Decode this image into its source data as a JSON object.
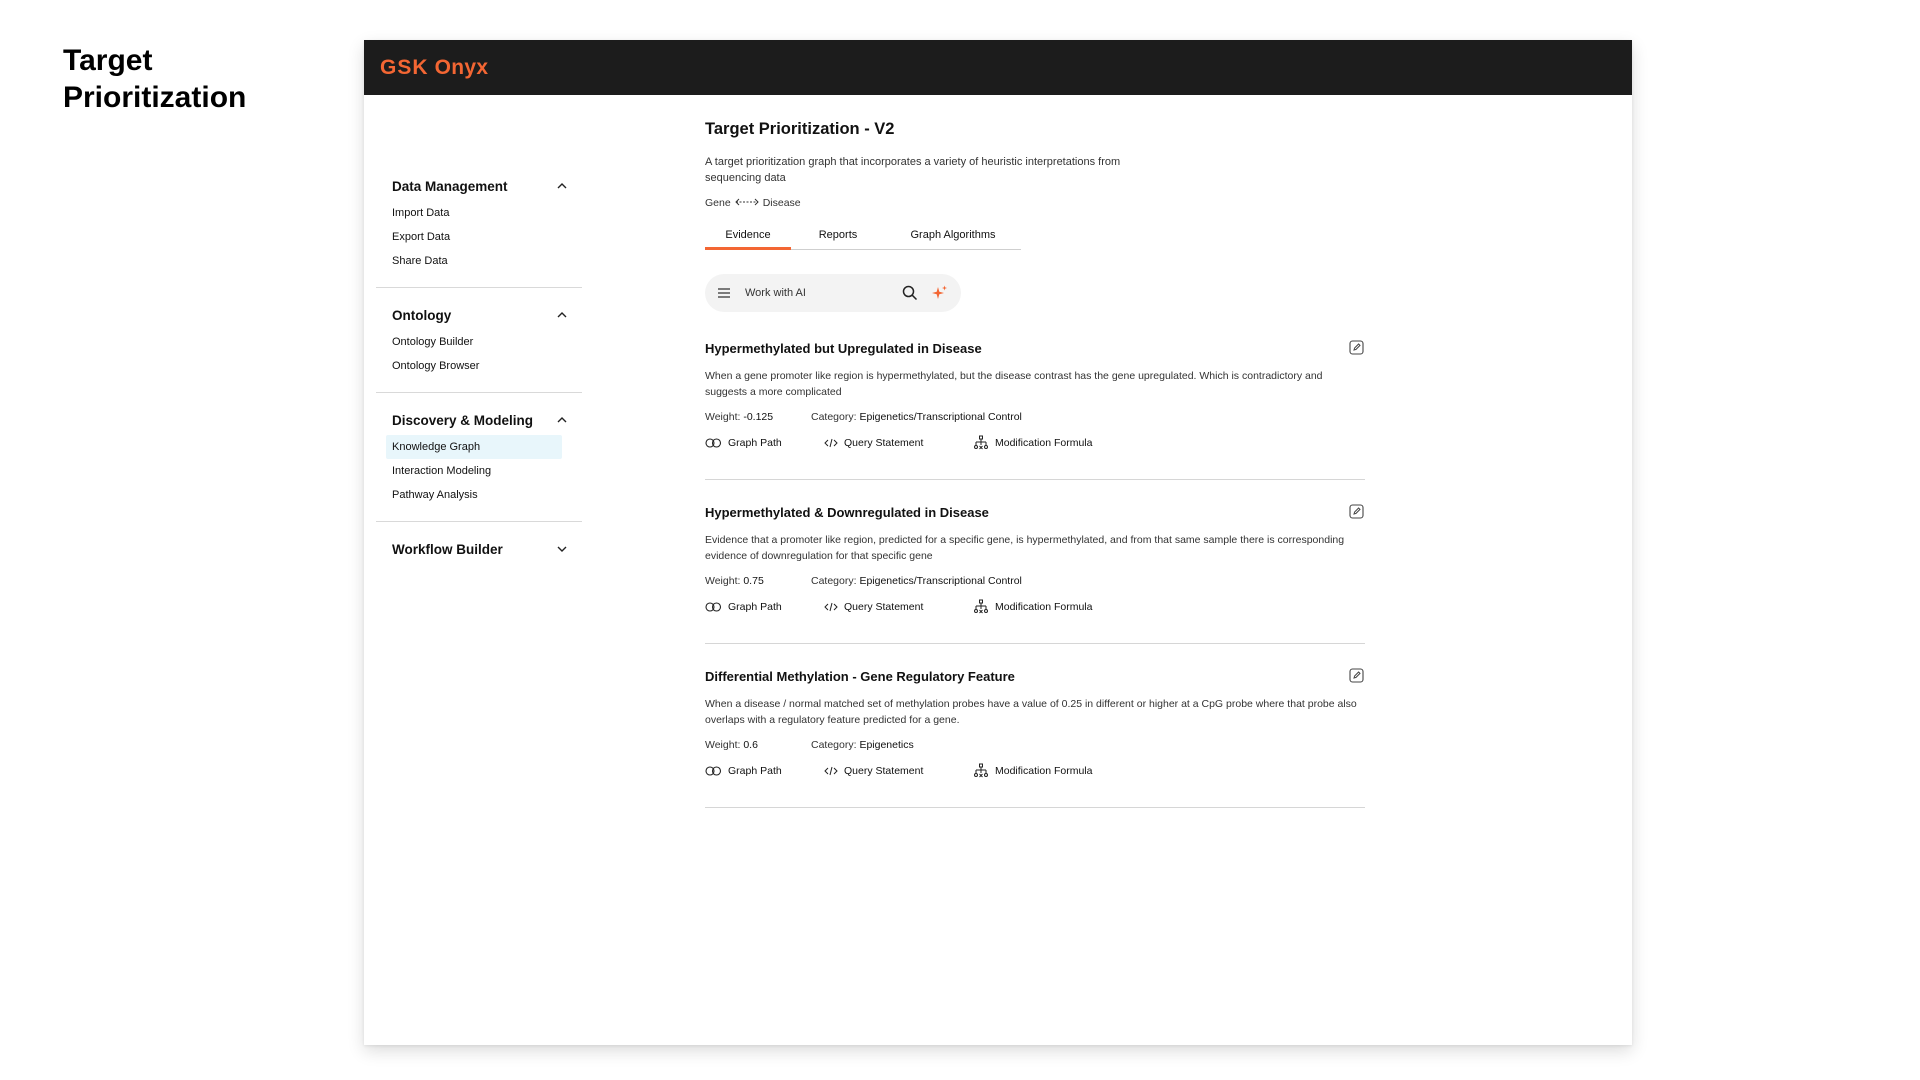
{
  "slide": {
    "title": "Target Prioritization"
  },
  "app": {
    "brand": {
      "gsk": "GSK",
      "product": "Onyx"
    }
  },
  "sidebar": {
    "sections": [
      {
        "title": "Data Management",
        "expanded": true,
        "items": [
          "Import Data",
          "Export Data",
          "Share Data"
        ]
      },
      {
        "title": "Ontology",
        "expanded": true,
        "items": [
          "Ontology Builder",
          "Ontology Browser"
        ]
      },
      {
        "title": "Discovery & Modeling",
        "expanded": true,
        "items": [
          "Knowledge Graph",
          "Interaction Modeling",
          "Pathway Analysis"
        ],
        "active": "Knowledge Graph"
      },
      {
        "title": "Workflow Builder",
        "expanded": false,
        "items": []
      }
    ]
  },
  "main": {
    "title": "Target Prioritization - V2",
    "description": "A target prioritization graph that incorporates a variety of heuristic interpretations from sequencing data",
    "relation": {
      "from": "Gene",
      "to": "Disease"
    },
    "tabs": [
      {
        "label": "Evidence",
        "active": true
      },
      {
        "label": "Reports",
        "active": false
      },
      {
        "label": "Graph Algorithms",
        "active": false
      }
    ],
    "search": {
      "placeholder": "Work with AI",
      "value": ""
    },
    "cards": [
      {
        "title": "Hypermethylated but Upregulated in Disease",
        "description": "When a gene promoter like region is hypermethylated, but the disease contrast has the gene upregulated. Which is contradictory and suggests a more complicated",
        "weight_label": "Weight:",
        "weight": "-0.125",
        "category_label": "Category:",
        "category": "Epigenetics/Transcriptional Control"
      },
      {
        "title": "Hypermethylated & Downregulated in Disease",
        "description": "Evidence that a promoter like region, predicted for a specific gene, is hypermethylated, and from that same sample there is corresponding evidence of downregulation for that specific gene",
        "weight_label": "Weight:",
        "weight": "0.75",
        "category_label": "Category:",
        "category": "Epigenetics/Transcriptional Control"
      },
      {
        "title": "Differential Methylation - Gene Regulatory Feature",
        "description": "When a disease / normal matched set of methylation probes have a value of 0.25 in different or higher at a CpG probe where that probe also overlaps with a regulatory feature predicted for a gene.",
        "weight_label": "Weight:",
        "weight": "0.6",
        "category_label": "Category:",
        "category": "Epigenetics"
      }
    ],
    "actions": {
      "graph_path": "Graph Path",
      "query_statement": "Query Statement",
      "modification_formula": "Modification Formula"
    }
  },
  "colors": {
    "accent": "#f36633",
    "topbar": "#1c1c1c",
    "active_nav": "#e8f6fb"
  },
  "icons": [
    "menu-icon",
    "search-icon",
    "sparkle-icon",
    "edit-icon",
    "graph-path-icon",
    "code-icon",
    "formula-icon",
    "chevron-up-icon",
    "chevron-down-icon",
    "double-arrow-icon"
  ]
}
